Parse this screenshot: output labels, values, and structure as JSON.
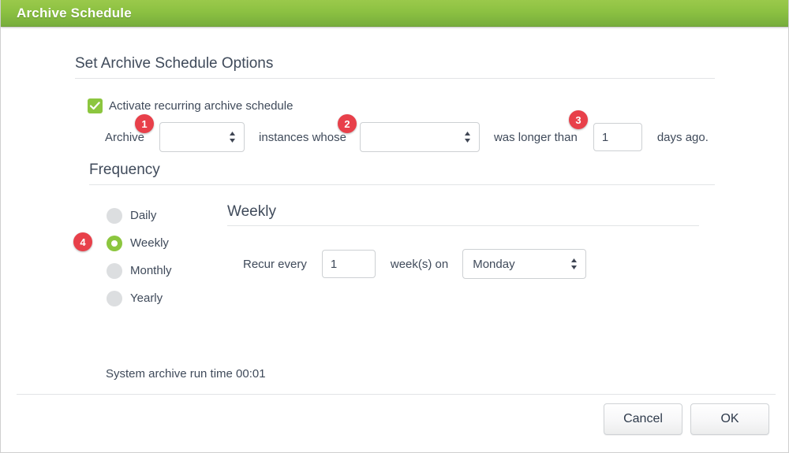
{
  "window": {
    "title": "Archive Schedule",
    "titlebar_color": "#8cc142"
  },
  "sections": {
    "options": {
      "title": "Set Archive Schedule Options",
      "activate_checkbox": {
        "label": "Activate recurring archive schedule",
        "checked": true,
        "color": "#8cc63f"
      },
      "archive_rule": {
        "prefix_label": "Archive",
        "type_select_value": "",
        "middle_label": "instances whose",
        "field_select_value": "",
        "condition_label": "was longer than",
        "days_value": "1",
        "suffix_label": "days ago."
      }
    },
    "frequency": {
      "title": "Frequency",
      "options": [
        {
          "label": "Daily",
          "selected": false
        },
        {
          "label": "Weekly",
          "selected": true
        },
        {
          "label": "Monthly",
          "selected": false
        },
        {
          "label": "Yearly",
          "selected": false
        }
      ]
    },
    "weekly": {
      "title": "Weekly",
      "recur_label": "Recur every",
      "interval_value": "1",
      "unit_label": "week(s) on",
      "day_value": "Monday"
    },
    "runtime_text": "System archive run time 00:01"
  },
  "badges": [
    {
      "number": "1"
    },
    {
      "number": "2"
    },
    {
      "number": "3"
    },
    {
      "number": "4"
    }
  ],
  "footer": {
    "cancel_label": "Cancel",
    "ok_label": "OK"
  }
}
